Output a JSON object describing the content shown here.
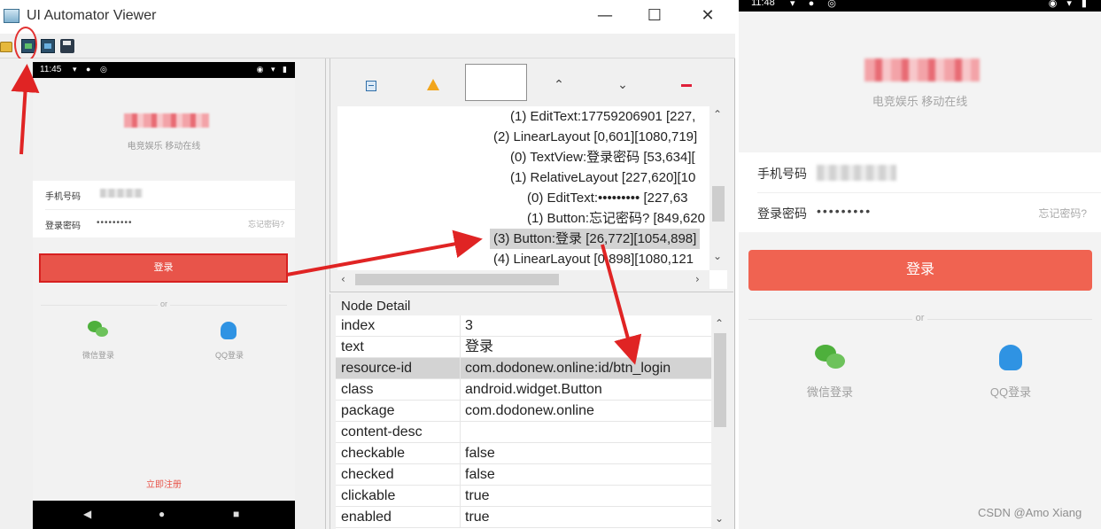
{
  "window": {
    "title": "UI Automator Viewer",
    "controls": {
      "minimize": "—",
      "maximize": "☐",
      "close": "✕"
    }
  },
  "toolbar": {
    "icons": [
      "folder-open-icon",
      "device-screenshot-icon",
      "device-screenshot-compressed-icon",
      "save-icon"
    ]
  },
  "phone_small": {
    "status_time": "11:45",
    "status_left_icons": "▾ ● ◎",
    "status_right_icons": "◉ ▾ ▮",
    "slogan": "电竞娱乐 移动在线",
    "phone_label": "手机号码",
    "password_label": "登录密码",
    "password_value": "•••••••••",
    "forgot": "忘记密码?",
    "login": "登录",
    "or": "or",
    "wechat": "微信登录",
    "qq": "QQ登录",
    "register": "立即注册",
    "nav": {
      "back": "◀",
      "home": "●",
      "recent": "■"
    }
  },
  "tree_tools": {
    "up": "⌃",
    "down": "⌄"
  },
  "tree": {
    "rows": [
      "(1) EditText:17759206901 [227,",
      "(2) LinearLayout [0,601][1080,719]",
      "(0) TextView:登录密码 [53,634][",
      "(1) RelativeLayout [227,620][10",
      "(0) EditText:••••••••• [227,63",
      "(1) Button:忘记密码? [849,620",
      "(3) Button:登录 [26,772][1054,898]",
      "(4) LinearLayout [0,898][1080,121"
    ],
    "selected_index": 6
  },
  "node_detail": {
    "title": "Node Detail",
    "rows": [
      {
        "key": "index",
        "value": "3"
      },
      {
        "key": "text",
        "value": "登录"
      },
      {
        "key": "resource-id",
        "value": "com.dodonew.online:id/btn_login"
      },
      {
        "key": "class",
        "value": "android.widget.Button"
      },
      {
        "key": "package",
        "value": "com.dodonew.online"
      },
      {
        "key": "content-desc",
        "value": ""
      },
      {
        "key": "checkable",
        "value": "false"
      },
      {
        "key": "checked",
        "value": "false"
      },
      {
        "key": "clickable",
        "value": "true"
      },
      {
        "key": "enabled",
        "value": "true"
      }
    ],
    "selected_index": 2
  },
  "phone_right": {
    "status_time": "11:48",
    "status_left_icons": "▾ ● ◎",
    "status_right_icons": "◉ ▾ ▮",
    "slogan": "电竞娱乐 移动在线",
    "phone_label": "手机号码",
    "password_label": "登录密码",
    "password_value": "•••••••••",
    "forgot": "忘记密码?",
    "login": "登录",
    "or": "or",
    "wechat": "微信登录",
    "qq": "QQ登录"
  },
  "watermark": "CSDN @Amo Xiang",
  "colors": {
    "annotation_red": "#e02424",
    "login_button": "#f06351",
    "selection_gray": "#d3d3d3"
  }
}
